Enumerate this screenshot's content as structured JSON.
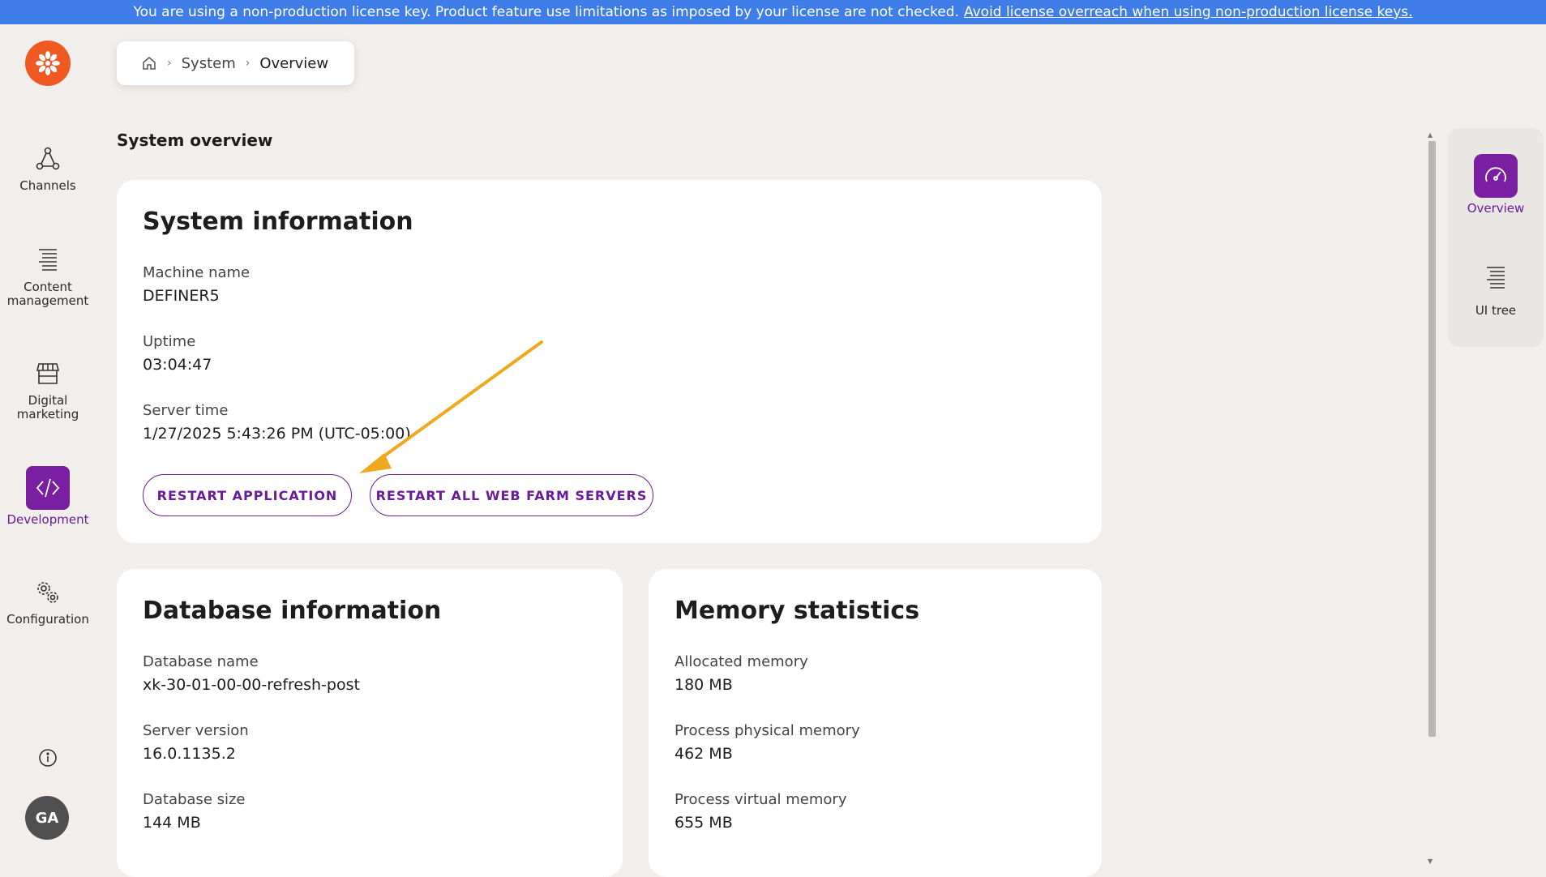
{
  "license_banner": {
    "text": "You are using a non-production license key. Product feature use limitations as imposed by your license are not checked.",
    "link": "Avoid license overreach when using non-production license keys."
  },
  "nav": {
    "items": [
      {
        "label": "Channels",
        "icon": "channels-icon"
      },
      {
        "label": "Content management",
        "icon": "content-list-icon"
      },
      {
        "label": "Digital marketing",
        "icon": "storefront-icon"
      },
      {
        "label": "Development",
        "icon": "code-icon",
        "active": true
      },
      {
        "label": "Configuration",
        "icon": "gears-icon"
      }
    ],
    "avatar_initials": "GA"
  },
  "breadcrumb": {
    "items": [
      "System",
      "Overview"
    ]
  },
  "page_title": "System overview",
  "system_info": {
    "title": "System information",
    "machine_name_label": "Machine name",
    "machine_name": "DEFINER5",
    "uptime_label": "Uptime",
    "uptime": "03:04:47",
    "server_time_label": "Server time",
    "server_time": "1/27/2025 5:43:26 PM (UTC-05:00)",
    "restart_app_label": "RESTART APPLICATION",
    "restart_farm_label": "RESTART ALL WEB FARM SERVERS"
  },
  "database_info": {
    "title": "Database information",
    "db_name_label": "Database name",
    "db_name": "xk-30-01-00-00-refresh-post",
    "server_version_label": "Server version",
    "server_version": "16.0.1135.2",
    "db_size_label": "Database size",
    "db_size": "144 MB"
  },
  "memory_stats": {
    "title": "Memory statistics",
    "allocated_label": "Allocated memory",
    "allocated": "180 MB",
    "physical_label": "Process physical memory",
    "physical": "462 MB",
    "virtual_label": "Process virtual memory",
    "virtual": "655 MB"
  },
  "right_panel": {
    "items": [
      {
        "label": "Overview",
        "icon": "gauge-icon",
        "active": true
      },
      {
        "label": "UI tree",
        "icon": "tree-list-icon"
      }
    ]
  },
  "colors": {
    "license_bar": "#3f7de8",
    "accent_purple": "#7b1fa2",
    "logo_orange": "#f05a22",
    "annotation_arrow": "#f0a91e"
  }
}
